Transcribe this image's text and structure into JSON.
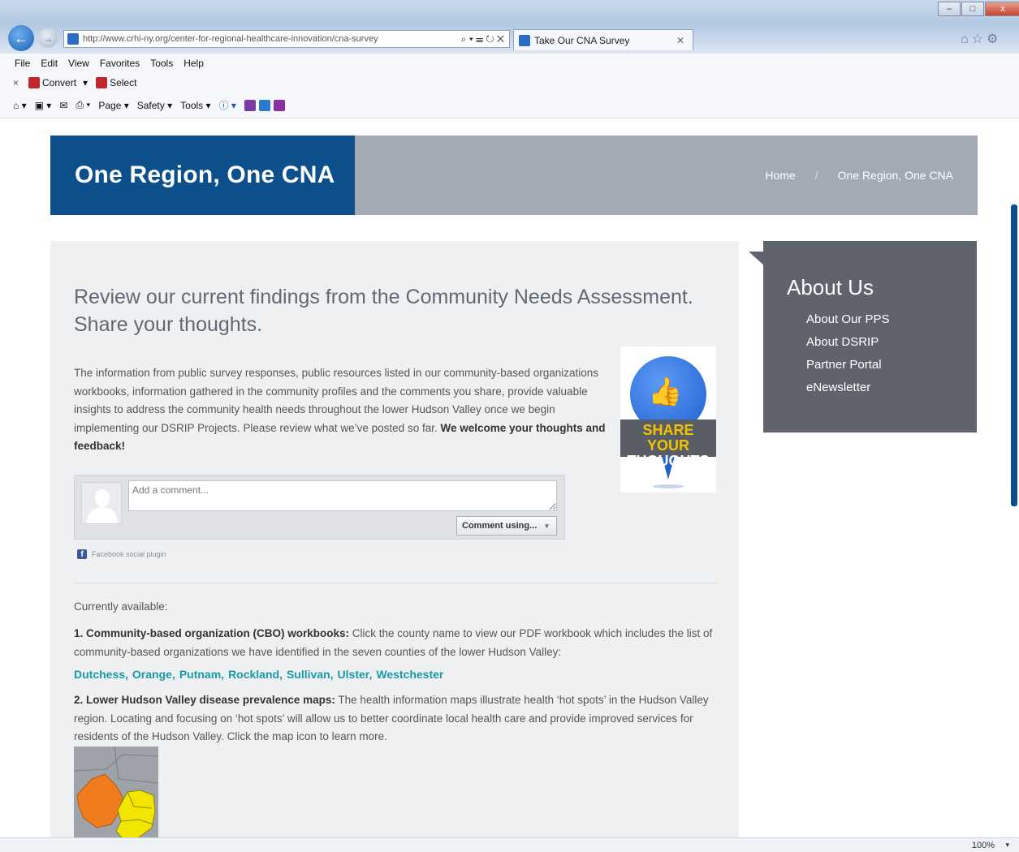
{
  "browser": {
    "url": "http://www.crhi-ny.org/center-for-regional-healthcare-innovation/cna-survey",
    "address_tools": "⌕ ▾ ☰ ↻ ✕",
    "tab_title": "Take Our CNA Survey",
    "tab_close": "✕",
    "back_glyph": "←",
    "forward_glyph": "→",
    "window_controls": {
      "minimize": "–",
      "restore": "□",
      "close": "x"
    },
    "right_icons": "⌂☆⚙",
    "menu": [
      "File",
      "Edit",
      "View",
      "Favorites",
      "Tools",
      "Help"
    ],
    "convert_bar": {
      "close": "×",
      "convert": "Convert",
      "convert_caret": "▾",
      "select": "Select"
    },
    "command_bar": {
      "home": "⌂ ▾",
      "feeds": "▣ ▾",
      "mail": "✉",
      "print": "⎙ ▾",
      "page": "Page ▾",
      "safety": "Safety ▾",
      "tools": "Tools ▾",
      "help": "ⓘ ▾"
    },
    "zoom": "100%",
    "zoom_caret": "▾"
  },
  "page": {
    "header_title": "One Region, One CNA",
    "breadcrumb": {
      "home": "Home",
      "separator": "/",
      "current": "One Region, One CNA"
    },
    "intro_heading": "Review our current findings from the Community Needs Assessment. Share your thoughts.",
    "intro_body": "The information from public survey responses, public resources listed in our community-based organizations workbooks, information gathered in the community profiles and the comments you share, provide valuable insights to address the community health needs throughout the lower Hudson Valley once we begin implementing our DSRIP Projects.  Please review what we’ve posted so far.",
    "intro_body_bold": "We welcome your thoughts and feedback!",
    "share_badge": {
      "line1": "SHARE YOUR",
      "line2": "THOUGHTS",
      "icon": "👍"
    },
    "comment": {
      "placeholder": "Add a comment...",
      "using_label": "Comment using...",
      "caret": "▾",
      "plugin_label": "Facebook social plugin",
      "fb_letter": "f"
    },
    "currently_available": "Currently available:",
    "item1_bold": "1. Community-based organization (CBO) workbooks:",
    "item1_text": " Click the county name to view our PDF workbook which includes the list of community-based organizations we have identified in the seven counties of the lower Hudson Valley:",
    "counties": [
      "Dutchess",
      "Orange",
      "Putnam",
      "Rockland",
      "Sullivan",
      "Ulster",
      "Westchester"
    ],
    "county_comma": ",",
    "item2_bold": "2. Lower Hudson Valley disease prevalence maps:",
    "item2_text": " The health information maps illustrate health ‘hot spots’ in the Hudson Valley region. Locating and focusing on ‘hot spots’ will allow us to better coordinate local health care and provide improved services for residents of the Hudson Valley. Click the map icon to learn more."
  },
  "sidebar": {
    "title": "About Us",
    "links": [
      "About Our PPS",
      "About DSRIP",
      "Partner Portal",
      "eNewsletter"
    ]
  },
  "colors": {
    "header_blue": "#0d4f8b",
    "header_grey": "#a2abb5",
    "sidebar_grey": "#5f646c",
    "link_teal": "#1a9aa8",
    "map_orange": "#f07c1e",
    "map_yellow": "#f2e600"
  }
}
